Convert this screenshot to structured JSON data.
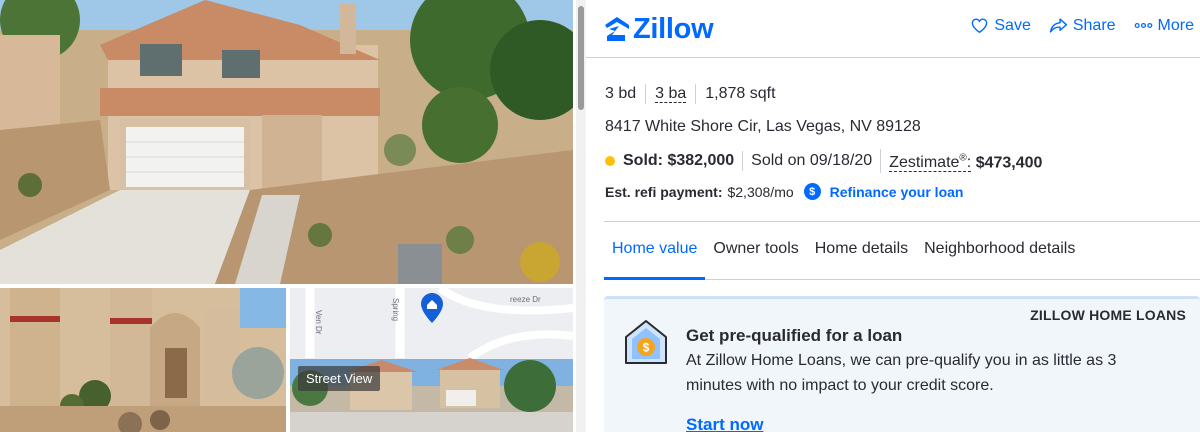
{
  "header": {
    "logo_text": "Zillow",
    "actions": [
      {
        "label": "Save",
        "icon": "heart-icon"
      },
      {
        "label": "Share",
        "icon": "share-icon"
      },
      {
        "label": "More",
        "icon": "more-dots-icon"
      }
    ]
  },
  "photos": {
    "street_view_label": "Street View"
  },
  "listing": {
    "beds": "3 bd",
    "baths": "3 ba",
    "sqft": "1,878 sqft",
    "address": "8417 White Shore Cir, Las Vegas, NV 89128",
    "status_label": "Sold: $382,000",
    "sold_on": "Sold on 09/18/20",
    "zestimate_label": "Zestimate",
    "zestimate_mark": "®",
    "zestimate_colon": ":",
    "zestimate_value": "$473,400",
    "status_color": "#ffc107"
  },
  "refinance": {
    "label": "Est. refi payment:",
    "value": "$2,308/mo",
    "coin_symbol": "$",
    "link": "Refinance your loan"
  },
  "tabs": [
    {
      "label": "Home value",
      "active": true
    },
    {
      "label": "Owner tools",
      "active": false
    },
    {
      "label": "Home details",
      "active": false
    },
    {
      "label": "Neighborhood details",
      "active": false
    }
  ],
  "loan_card": {
    "brand": "ZILLOW HOME LOANS",
    "title": "Get pre-qualified for a loan",
    "text": "At Zillow Home Loans, we can pre-qualify you in as little as 3 minutes with no impact to your credit score.",
    "cta": "Start now",
    "coin_symbol": "$"
  },
  "colors": {
    "accent": "#006aff",
    "text": "#2a2a33"
  }
}
